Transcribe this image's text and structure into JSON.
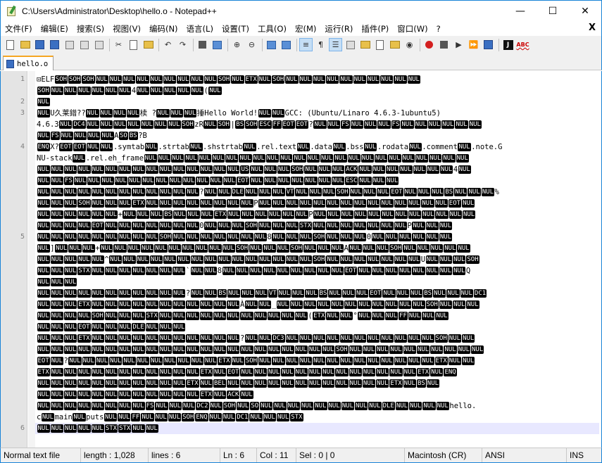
{
  "window": {
    "title": "C:\\Users\\Administrator\\Desktop\\hello.o - Notepad++",
    "controls": {
      "minimize": "—",
      "maximize": "☐",
      "close": "✕"
    }
  },
  "menu": {
    "items": [
      "文件(F)",
      "编辑(E)",
      "搜索(S)",
      "视图(V)",
      "编码(N)",
      "语言(L)",
      "设置(T)",
      "工具(O)",
      "宏(M)",
      "运行(R)",
      "插件(P)",
      "窗口(W)",
      "?"
    ],
    "close_doc": "X"
  },
  "toolbar": {
    "record_text": "J",
    "spell_text": "ABC"
  },
  "tabs": [
    {
      "label": "hello.o"
    }
  ],
  "editor": {
    "line_numbers": [
      "1",
      "2",
      "3",
      "4",
      "5",
      "6"
    ],
    "rows": [
      "⊡ELF SOH SOH SOH NUL NUL NUL NUL NUL NUL NUL NUL NUL SOH NUL ETX NUL SOH NUL NUL NUL NUL NUL NUL NUL NUL NUL NUL",
      "SOH NUL NUL NUL NUL NUL NUL 4 NUL NUL NUL NUL NUL ( NUL",
      "NUL",
      "NUL U久莱錯??NUL NUL NUL NUL 椟       ?NUL NUL NUL 捶Hello World!NUL NUL GCC: (Ubuntu/Linaro 4.6.3-1ubuntu5)",
      "4.6.3 NUL DC4 NUL NUL NUL NUL NUL NUL NUL SOH zR NUL SOH | BS SOH ESC FF EOT EOT ?NUL NUL FS NUL NUL NUL FS NUL NUL NUL NUL NUL NUL",
      "NUL FS NUL NUL NUL NUL A SO BS ?B",
      "ENQ X?EOT EOT NUL NUL .symtab NUL .strtab NUL .shstrtab NUL .rel.text NUL .data NUL .bss NUL .rodata NUL .comment NUL .note.G",
      "NU-stack NUL .rel.eh_frame NUL NUL NUL NUL NUL NUL NUL NUL NUL NUL NUL NUL NUL NUL NUL NUL NUL NUL NUL NUL NUL NUL NUL NUL",
      "NUL NUL NUL NUL NUL NUL NUL NUL NUL NUL NUL NUL NUL NUL NUL US NUL NUL NUL SOH NUL NUL NUL ACK NUL NUL NUL NUL NUL NUL NUL 4 NUL",
      "NUL NUL FS NUL NUL NUL NUL NUL NUL NUL NUL NUL NUL NUL NUL EOT NUL NUL NUL NUL NUL NUL NUL ESC NUL NUL NUL",
      "NUL NUL NUL NUL NUL NUL NUL NUL NUL NUL NUL NUL ?NUL NUL DLE NUL NUL NUL VT NUL NUL NUL SOH NUL NUL NUL EOT NUL NUL NUL BS NUL NUL NUL %",
      "NUL NUL NUL SOH NUL NUL NUL ETX NUL NUL NUL NUL NUL NUL NUL NUL P NUL NUL NUL NUL NUL NUL NUL NUL NUL NUL NUL NUL NUL NUL EOT NUL",
      "NUL NUL NUL NUL NUL NUL + NUL NUL NUL BS NUL NUL NUL ETX NUL NUL NUL NUL NUL NUL P NUL NUL NUL NUL NUL NUL NUL NUL NUL NUL NUL NUL",
      "NUL NUL NUL NUL EOT NUL NUL NUL NUL NUL NUL NUL 0 NUL NUL NUL SOH NUL NUL NUL STX NUL NUL NUL NUL NUL NUL NUL P NUL NUL NUL",
      "NUL NUL NUL NUL NUL NUL NUL NUL NUL SOH NUL NUL NUL NUL NUL NUL NUL 8 NUL NUL NUL SOH NUL NUL NUL 0 NUL NUL NUL NUL NUL NUL",
      "NUL ] NUL NUL NUL + NUL NUL NUL NUL NUL NUL NUL NUL NUL NUL SOH NUL NUL NUL SOH NUL NUL NUL A NUL NUL NUL SOH NUL NUL NUL NUL NUL",
      "NUL NUL NUL NUL NUL ^ NUL NUL NUL NUL NUL NUL NUL NUL NUL NUL NUL NUL NUL NUL NUL SOH NUL NUL NUL NUL NUL NUL NUL U NUL NUL NUL SOH",
      "NUL NUL NUL STX NUL NUL NUL NUL NUL NUL NUL ` NUL NUL 8 NUL NUL NUL NUL NUL NUL NUL NUL NUL EOT NUL NUL NUL NUL NUL NUL NUL NUL Q",
      "NUL NUL NUL",
      "NUL NUL NUL NUL NUL NUL NUL NUL NUL NUL NUL ?NUL NUL BS NUL NUL NUL VT NUL NUL NUL BS NUL NUL NUL EOT NUL NUL NUL BS NUL NUL NUL DC1",
      "NUL NUL NUL ETX NUL NUL NUL NUL NUL NUL NUL NUL NUL NUL NUL À NUL NUL _ NUL NUL NUL NUL NUL NUL NUL NUL NUL NUL NUL SOH NUL NUL NUL",
      "NUL NUL NUL NUL SOH NUL NUL NUL STX NUL NUL NUL NUL NUL NUL NUL NUL NUL NUL NUL ( ETX NUL NUL ° NUL NUL NUL FF NUL NUL NUL",
      "NUL NUL NUL EOT NUL NUL NUL DLE NUL NUL NUL",
      "NUL NUL NUL ETX NUL NUL NUL NUL NUL NUL NUL NUL NUL NUL NUL ?NUL NUL DC3 NUL NUL NUL NUL NUL NUL NUL NUL NUL NUL NUL SOH NUL NUL",
      "NUL NUL NUL NUL NUL NUL NUL NUL NUL NUL NUL NUL NUL NUL NUL NUL NUL NUL NUL NUL NUL NUL SOH NUL NUL NUL NUL NUL NUL NUL NUL NUL NUL",
      "EOT NUL ?NUL NUL NUL NUL NUL NUL NUL NUL NUL NUL NUL ETX NUL SOH NUL NUL NUL NUL NUL NUL NUL NUL NUL NUL NUL NUL NUL ETX NUL NUL",
      "ETX NUL NUL NUL NUL NUL NUL NUL NUL NUL NUL NUL ETX NUL EOT NUL NUL NUL NUL NUL NUL NUL NUL NUL NUL NUL NUL NUL ETX NUL ENQ",
      "NUL NUL NUL NUL NUL NUL NUL NUL NUL NUL NUL ETX NUL BEL NUL NUL NUL NUL NUL NUL NUL NUL NUL NUL NUL NUL ETX NUL BS NUL",
      "NUL NUL NUL NUL NUL NUL NUL NUL NUL NUL NUL NUL ETX NUL ACK NUL",
      "NUL NUL NUL NUL NUL NUL NUL NUL FS NUL NUL NUL DC2 NUL SOH NUL SO NUL NUL NUL NUL NUL NUL NUL NUL NUL DLE NUL NUL NUL NUL hello.",
      "c NUL main NUL puts NUL NUL FF NUL NUL NUL SOH ENQ NUL NUL DC1 NUL NUL NUL STX",
      "NUL NUL  NUL NUL NUL STX STX NUL NUL"
    ],
    "line_starts": [
      0,
      2,
      3,
      6,
      14,
      31
    ]
  },
  "status": {
    "type": "Normal text file",
    "length": "length : 1,028",
    "lines": "lines : 6",
    "ln": "Ln : 6",
    "col": "Col : 11",
    "sel": "Sel : 0 | 0",
    "eol": "Macintosh (CR)",
    "encoding": "ANSI",
    "mode": "INS"
  }
}
